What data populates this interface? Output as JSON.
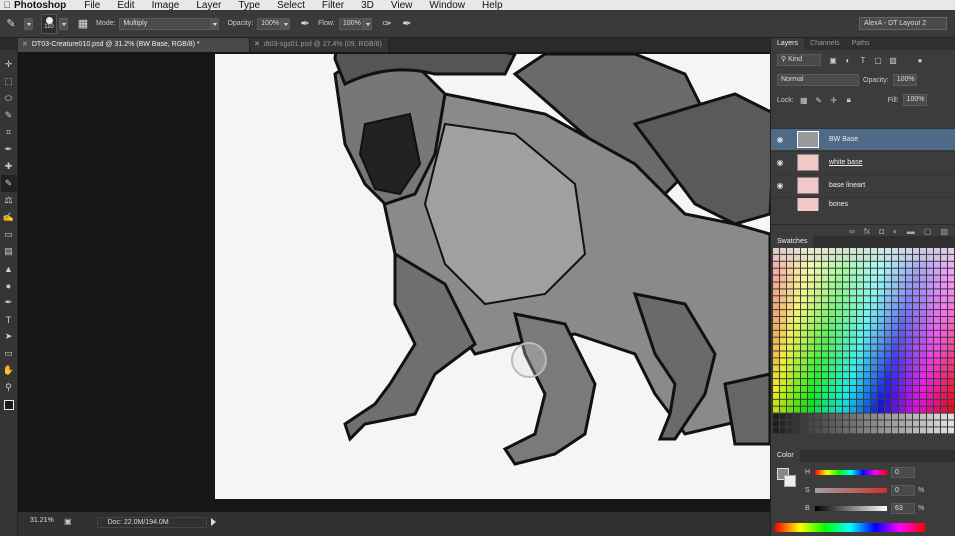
{
  "menu": {
    "app": "Photoshop",
    "items": [
      "File",
      "Edit",
      "Image",
      "Layer",
      "Type",
      "Select",
      "Filter",
      "3D",
      "View",
      "Window",
      "Help"
    ]
  },
  "options": {
    "brush_size": "110",
    "mode_label": "Mode:",
    "mode_value": "Multiply",
    "opacity_label": "Opacity:",
    "opacity_value": "100%",
    "flow_label": "Flow:",
    "flow_value": "100%",
    "workspace": "AlexA - DT Layout 2"
  },
  "tabs": [
    {
      "label": "DT03-Creature010.psd @ 31.2% (BW Base, RGB/8) *",
      "active": true
    },
    {
      "label": "dt03-sgs01.psd @ 27.4% (09, RGB/8)",
      "active": false
    }
  ],
  "status": {
    "zoom": "31.21%",
    "doc": "Doc: 22.0M/194.0M"
  },
  "layers_panel": {
    "tabs": [
      "Layers",
      "Channels",
      "Paths"
    ],
    "kind_label": "Kind",
    "blend_mode": "Normal",
    "opacity_label": "Opacity:",
    "opacity_value": "100%",
    "lock_label": "Lock:",
    "fill_label": "Fill:",
    "fill_value": "100%",
    "layers": [
      {
        "name": "BW Base",
        "selected": true
      },
      {
        "name": "white base",
        "selected": false
      },
      {
        "name": "base lineart",
        "selected": false
      },
      {
        "name": "bones",
        "selected": false
      }
    ]
  },
  "swatches_panel": {
    "title": "Swatches"
  },
  "color_panel": {
    "title": "Color",
    "h_label": "H",
    "h_value": "0",
    "s_label": "S",
    "s_value": "0",
    "b_label": "B",
    "b_value": "63",
    "pct": "%",
    "colors": {
      "foreground": "#888888",
      "background": "#eeeeee"
    }
  },
  "tools": [
    "move-icon",
    "marquee-icon",
    "lasso-icon",
    "quick-select-icon",
    "crop-icon",
    "eyedropper-icon",
    "healing-icon",
    "brush-icon",
    "stamp-icon",
    "history-brush-icon",
    "eraser-icon",
    "gradient-icon",
    "blur-icon",
    "dodge-icon",
    "pen-icon",
    "type-icon",
    "path-select-icon",
    "shape-icon",
    "hand-icon",
    "zoom-icon"
  ]
}
